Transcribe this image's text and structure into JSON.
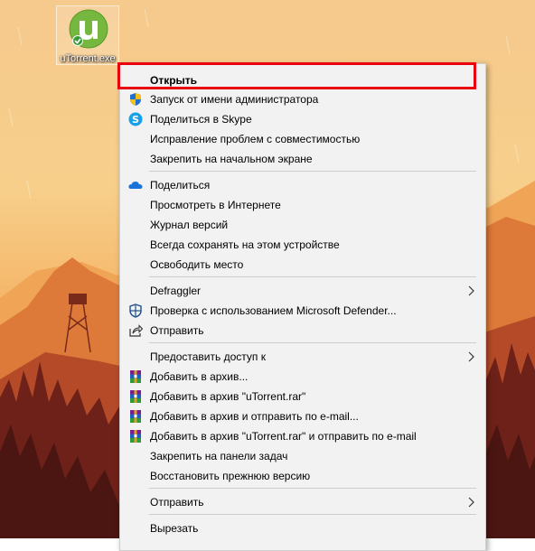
{
  "desktop": {
    "file_label": "uTorrent.exe"
  },
  "colors": {
    "highlight": "#e8000f",
    "menu_bg": "#f2f2f2",
    "separator": "#cdcdcd",
    "utorrent_green": "#76b83f"
  },
  "context_menu": {
    "items": [
      {
        "label": "Открыть",
        "icon": "none",
        "bold": true
      },
      {
        "label": "Запуск от имени администратора",
        "icon": "uac-shield-icon"
      },
      {
        "label": "Поделиться в Skype",
        "icon": "skype-icon"
      },
      {
        "label": "Исправление проблем с совместимостью",
        "icon": "none"
      },
      {
        "label": "Закрепить на начальном экране",
        "icon": "none"
      },
      {
        "label": "Поделиться",
        "icon": "onedrive-cloud-icon"
      },
      {
        "label": "Просмотреть в Интернете",
        "icon": "none"
      },
      {
        "label": "Журнал версий",
        "icon": "none"
      },
      {
        "label": "Всегда сохранять на этом устройстве",
        "icon": "none"
      },
      {
        "label": "Освободить место",
        "icon": "none"
      },
      {
        "label": "Defraggler",
        "icon": "none",
        "submenu": true
      },
      {
        "label": "Проверка с использованием Microsoft Defender...",
        "icon": "defender-shield-icon"
      },
      {
        "label": "Отправить",
        "icon": "share-icon"
      },
      {
        "label": "Предоставить доступ к",
        "icon": "none",
        "submenu": true
      },
      {
        "label": "Добавить в архив...",
        "icon": "winrar-icon"
      },
      {
        "label": "Добавить в архив \"uTorrent.rar\"",
        "icon": "winrar-icon"
      },
      {
        "label": "Добавить в архив и отправить по e-mail...",
        "icon": "winrar-icon"
      },
      {
        "label": "Добавить в архив \"uTorrent.rar\" и отправить по e-mail",
        "icon": "winrar-icon"
      },
      {
        "label": "Закрепить на панели задач",
        "icon": "none"
      },
      {
        "label": "Восстановить прежнюю версию",
        "icon": "none"
      },
      {
        "label": "Отправить",
        "icon": "none",
        "submenu": true
      },
      {
        "label": "Вырезать",
        "icon": "none"
      }
    ]
  }
}
